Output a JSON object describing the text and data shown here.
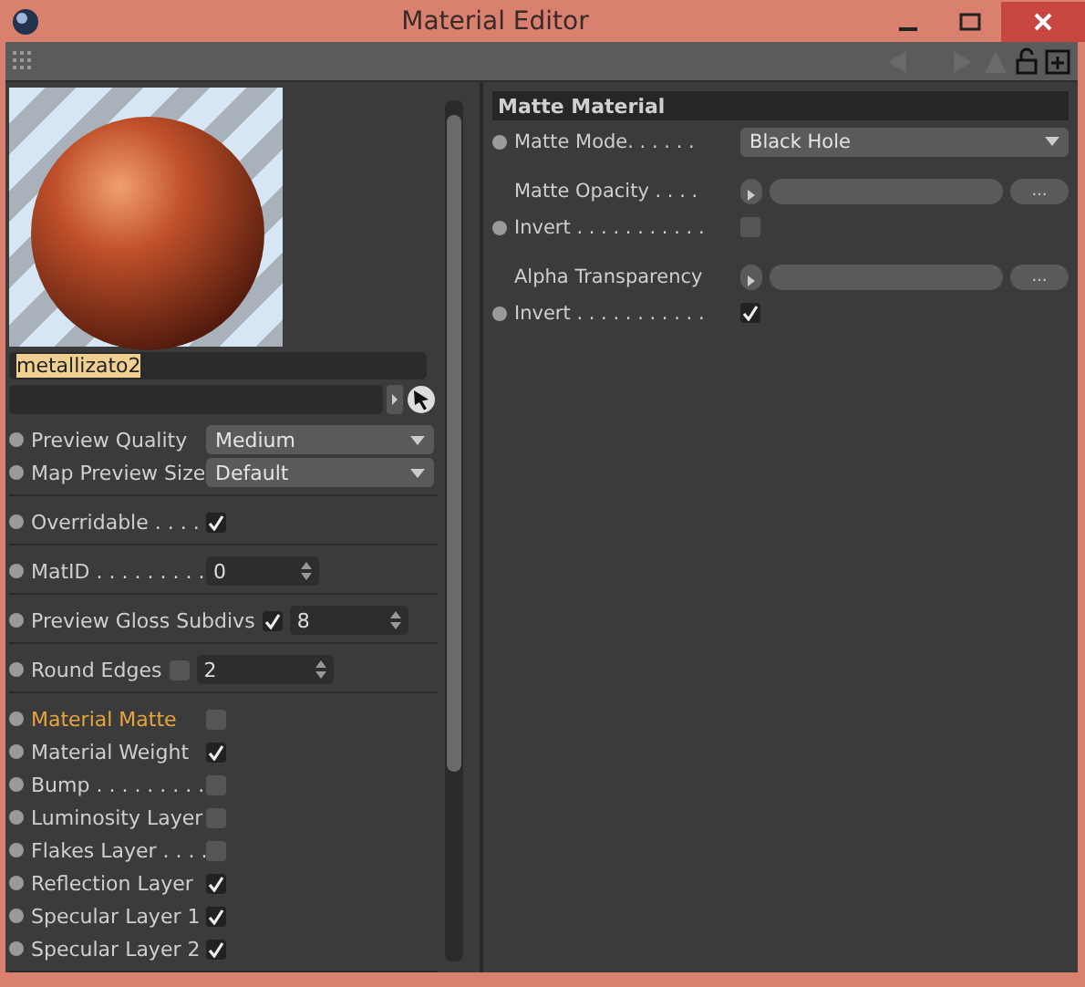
{
  "window": {
    "title": "Material Editor"
  },
  "material": {
    "name": "metallizato2"
  },
  "left_groups": [
    [
      {
        "kind": "dropdown",
        "label": "Preview Quality",
        "value": "Medium"
      },
      {
        "kind": "dropdown",
        "label": "Map Preview Size",
        "value": "Default"
      }
    ],
    [
      {
        "kind": "checkbox",
        "label": "Overridable . . . .",
        "checked": true
      }
    ],
    [
      {
        "kind": "spinner",
        "label": "MatID . . . . . . . . .",
        "value": "0"
      }
    ],
    [
      {
        "kind": "check-spinner",
        "label": "Preview Gloss Subdivs",
        "checked": true,
        "value": "8"
      }
    ],
    [
      {
        "kind": "check-spinner",
        "label": "Round Edges",
        "checked": false,
        "value": "2"
      }
    ],
    [
      {
        "kind": "checkbox",
        "label": "Material Matte",
        "checked": false,
        "selected": true
      },
      {
        "kind": "checkbox",
        "label": "Material Weight",
        "checked": true,
        "selected": false
      },
      {
        "kind": "checkbox",
        "label": "Bump . . . . . . . . .",
        "checked": false,
        "selected": false
      },
      {
        "kind": "checkbox",
        "label": "Luminosity Layer",
        "checked": false,
        "selected": false
      },
      {
        "kind": "checkbox",
        "label": "Flakes Layer . . . .",
        "checked": false,
        "selected": false
      },
      {
        "kind": "checkbox",
        "label": "Reflection Layer",
        "checked": true,
        "selected": false
      },
      {
        "kind": "checkbox",
        "label": "Specular Layer 1",
        "checked": true,
        "selected": false
      },
      {
        "kind": "checkbox",
        "label": "Specular Layer 2",
        "checked": true,
        "selected": false
      }
    ]
  ],
  "right_panel": {
    "title": "Matte Material",
    "rows": [
      {
        "kind": "dropdown",
        "label": "Matte Mode. . . . . .",
        "value": "Black Hole"
      },
      {
        "kind": "texture",
        "label": "Matte Opacity . . . .",
        "button": "..."
      },
      {
        "kind": "checkbox",
        "label": "Invert . . . . . . . . . . .",
        "checked": false
      },
      {
        "kind": "texture",
        "label": "Alpha Transparency",
        "button": "..."
      },
      {
        "kind": "checkbox",
        "label": "Invert . . . . . . . . . . .",
        "checked": true
      }
    ]
  }
}
